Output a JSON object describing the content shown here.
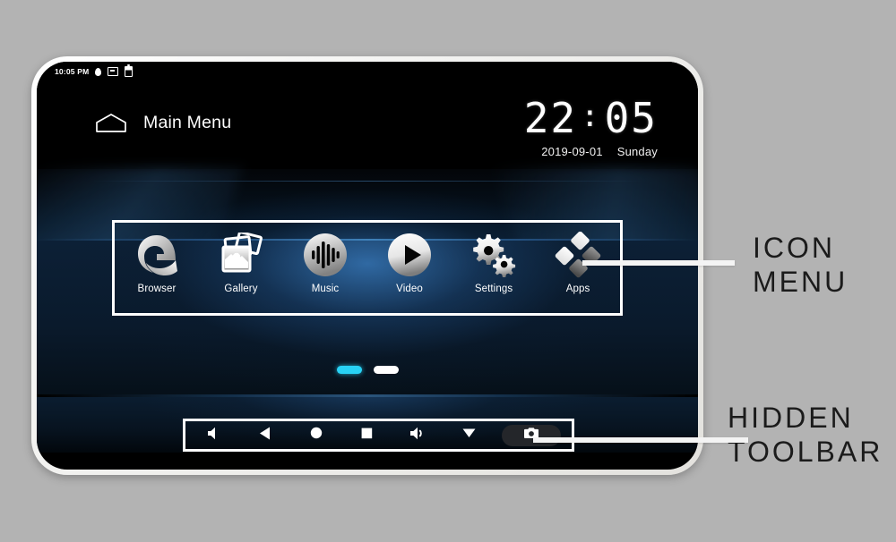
{
  "device": {
    "status_bar": {
      "time": "10:05 PM",
      "icons": [
        "location-icon",
        "sim-card-icon",
        "battery-icon"
      ]
    },
    "header": {
      "home_icon": "home-pentagon-icon",
      "title": "Main Menu",
      "clock": {
        "hours": "22",
        "separator": ":",
        "minutes": "05"
      },
      "date": "2019-09-01",
      "weekday": "Sunday"
    },
    "icon_menu": {
      "apps": [
        {
          "label": "Browser",
          "icon": "edge-browser-icon"
        },
        {
          "label": "Gallery",
          "icon": "gallery-photos-icon"
        },
        {
          "label": "Music",
          "icon": "music-waveform-icon"
        },
        {
          "label": "Video",
          "icon": "video-play-icon"
        },
        {
          "label": "Settings",
          "icon": "settings-gears-icon"
        },
        {
          "label": "Apps",
          "icon": "apps-diamond-icon"
        }
      ]
    },
    "page_indicator": {
      "pages": 2,
      "active_index": 0,
      "active_color": "#28d2f5",
      "inactive_color": "#ffffff"
    },
    "toolbar": {
      "buttons": [
        {
          "name": "volume-down-button",
          "icon": "speaker-mute-icon"
        },
        {
          "name": "back-button",
          "icon": "triangle-left-icon"
        },
        {
          "name": "home-button",
          "icon": "circle-icon"
        },
        {
          "name": "recents-button",
          "icon": "square-icon"
        },
        {
          "name": "volume-up-button",
          "icon": "speaker-wave-icon"
        },
        {
          "name": "hide-toolbar-button",
          "icon": "triangle-down-icon"
        },
        {
          "name": "screenshot-button",
          "icon": "camera-icon"
        }
      ]
    }
  },
  "annotations": [
    {
      "line1": "ICON",
      "line2": "MENU"
    },
    {
      "line1": "HIDDEN",
      "line2": "TOOLBAR"
    }
  ],
  "colors": {
    "page_background": "#b3b3b3",
    "screen_background": "#000000",
    "highlight_box": "#ffffff",
    "accent_cyan": "#28d2f5",
    "annotation_text": "#1b1b1b"
  }
}
